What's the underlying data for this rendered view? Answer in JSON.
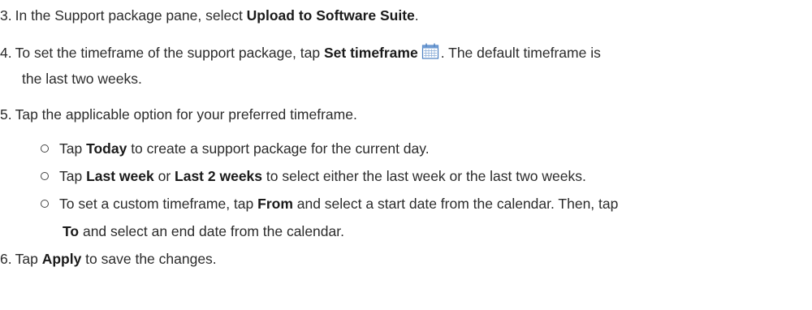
{
  "steps": {
    "step3": {
      "num": "3.",
      "pre": "In the Support package pane, select ",
      "bold": "Upload to Software Suite",
      "post": "."
    },
    "step4": {
      "num": "4.",
      "pre": "To set the timeframe of the support package, tap ",
      "bold": "Set timeframe",
      "post": ". The default timeframe is",
      "cont": "the last two weeks.",
      "icon": "calendar-icon"
    },
    "step5": {
      "num": "5.",
      "text": "Tap the applicable option for your preferred timeframe."
    },
    "step6": {
      "num": "6.",
      "pre": "Tap ",
      "bold": "Apply",
      "post": " to save the changes."
    }
  },
  "bullets": {
    "b1": {
      "pre": "Tap ",
      "bold": "Today",
      "post": " to create a support package for the current day."
    },
    "b2": {
      "pre": "Tap ",
      "bold1": "Last week",
      "mid": " or ",
      "bold2": "Last 2 weeks",
      "post": " to select either the last week or the last two weeks."
    },
    "b3": {
      "pre": "To set a custom timeframe, tap ",
      "bold1": "From",
      "mid": " and select a start date from the calendar. Then, tap",
      "bold2": "To",
      "post": " and select an end date from the calendar."
    }
  },
  "colors": {
    "text": "#2b2b2b",
    "icon_blue": "#4a7fc1"
  }
}
